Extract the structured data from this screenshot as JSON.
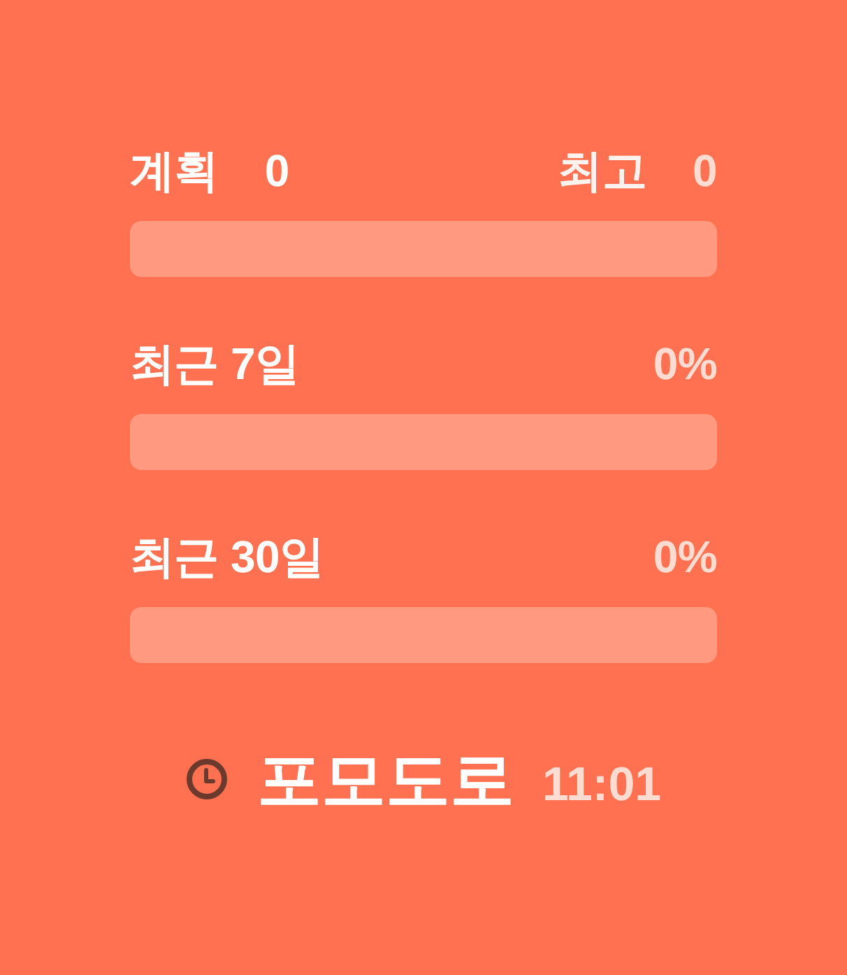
{
  "rows": [
    {
      "kind": "counts",
      "left_label": "계획",
      "left_value": "0",
      "right_label": "최고",
      "right_value": "0",
      "level": 0
    },
    {
      "kind": "percent",
      "label": "최근 7일",
      "value": "0%",
      "level": 0
    },
    {
      "kind": "percent",
      "label": "최근 30일",
      "value": "0%",
      "level": 0
    }
  ],
  "timer": {
    "label": "포모도로",
    "time": "11:01"
  }
}
